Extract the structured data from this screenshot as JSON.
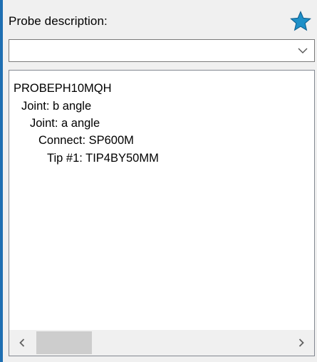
{
  "probe": {
    "label": "Probe description:",
    "favorite_icon": "star-icon",
    "favorite_color": "#1e90c8",
    "description_value": "",
    "dropdown_icon": "chevron-down-icon"
  },
  "tree": {
    "items": [
      {
        "text": "PROBEPH10MQH"
      },
      {
        "text": "Joint: b angle"
      },
      {
        "text": "Joint: a angle"
      },
      {
        "text": "Connect: SP600M"
      },
      {
        "text": "Tip #1: TIP4BY50MM"
      }
    ],
    "scrollbar": {
      "left_icon": "chevron-left-icon",
      "right_icon": "chevron-right-icon"
    }
  }
}
